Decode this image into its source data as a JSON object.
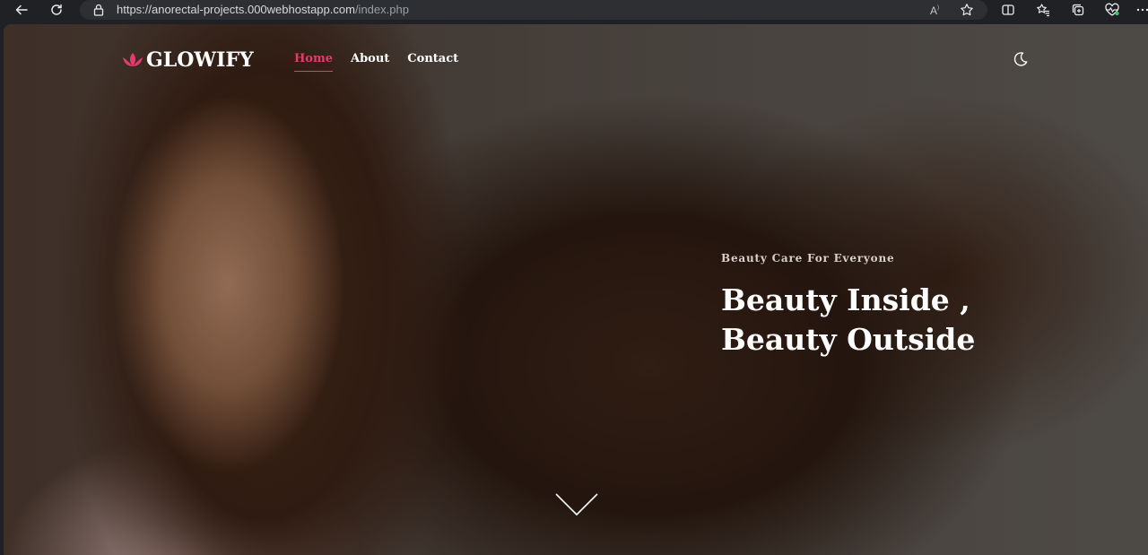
{
  "browser": {
    "url_host": "https://anorectal-projects.000webhostapp.com",
    "url_path": "/index.php",
    "icons": [
      "back-arrow-icon",
      "refresh-icon",
      "lock-icon",
      "read-aloud-icon",
      "favorite-star-icon",
      "split-screen-icon",
      "favorites-icon",
      "collections-icon",
      "health-icon",
      "more-icon"
    ]
  },
  "site": {
    "logo_text": "GLOWIFY",
    "logo_icon": "lotus-icon",
    "nav": [
      {
        "label": "Home",
        "active": true
      },
      {
        "label": "About",
        "active": false
      },
      {
        "label": "Contact",
        "active": false
      }
    ],
    "theme_toggle_icon": "moon-icon",
    "hero": {
      "subtitle": "Beauty Care For Everyone",
      "headline_line1": "Beauty Inside ,",
      "headline_line2": "Beauty Outside",
      "scroll_icon": "chevron-down-icon"
    },
    "colors": {
      "accent": "#e33b6e",
      "text": "#ffffff"
    }
  }
}
